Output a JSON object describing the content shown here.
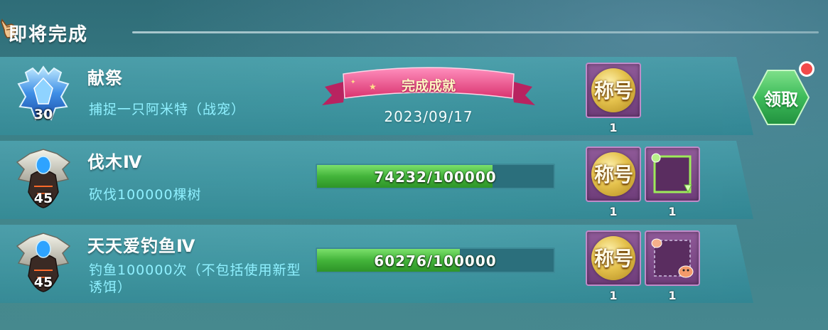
{
  "header": {
    "title": "即将完成",
    "icon": "pointing-hand-icon"
  },
  "achievements": [
    {
      "name": "献祭",
      "level": "30",
      "description": "捕捉一只阿米特（战宠）",
      "medal": "blue-crystal-medal-icon",
      "status_label": "完成成就",
      "completed_date": "2023/09/17",
      "rewards": [
        {
          "label": "称号",
          "count": "1",
          "icon": "title-badge-icon"
        }
      ]
    },
    {
      "name": "伐木Ⅳ",
      "level": "45",
      "description": "砍伐100000棵树",
      "medal": "silver-dark-medal-icon",
      "progress_text": "74232/100000",
      "progress_value": 0.74232,
      "rewards": [
        {
          "label": "称号",
          "count": "1",
          "icon": "title-badge-icon"
        },
        {
          "label": "",
          "count": "1",
          "icon": "green-frame-icon"
        }
      ]
    },
    {
      "name": "天天爱钓鱼Ⅳ",
      "level": "45",
      "description": "钓鱼100000次（不包括使用新型诱饵）",
      "medal": "silver-dark-medal-icon",
      "progress_text": "60276/100000",
      "progress_value": 0.60276,
      "rewards": [
        {
          "label": "称号",
          "count": "1",
          "icon": "title-badge-icon"
        },
        {
          "label": "",
          "count": "1",
          "icon": "hamster-frame-icon"
        }
      ]
    }
  ],
  "claim_button": {
    "label": "领取",
    "has_notification": true
  },
  "colors": {
    "description": "#8ff0ff",
    "progress_fill": "#43b43a",
    "claim_button": "#3dbb5a",
    "ribbon": "#e94a8c",
    "notification_dot": "#f24a4a"
  }
}
